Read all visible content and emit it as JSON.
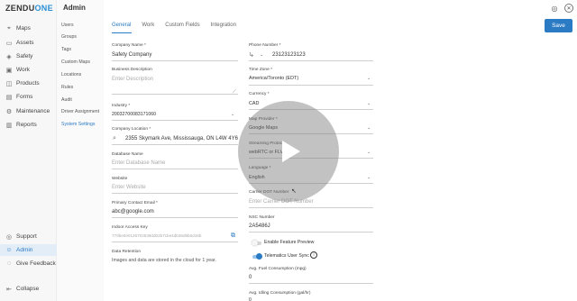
{
  "app": {
    "logo_main": "ZENDU",
    "logo_accent": "ONE",
    "page_title": "Admin"
  },
  "sidebar": {
    "items": [
      {
        "label": "Maps",
        "icon": "map-pin-icon"
      },
      {
        "label": "Assets",
        "icon": "car-icon"
      },
      {
        "label": "Safety",
        "icon": "shield-icon"
      },
      {
        "label": "Work",
        "icon": "briefcase-icon"
      },
      {
        "label": "Products",
        "icon": "box-icon"
      },
      {
        "label": "Forms",
        "icon": "document-icon"
      },
      {
        "label": "Maintenance",
        "icon": "wrench-icon"
      },
      {
        "label": "Reports",
        "icon": "chart-icon"
      }
    ],
    "bottom_items": [
      {
        "label": "Support",
        "icon": "headset-icon"
      },
      {
        "label": "Admin",
        "icon": "person-icon"
      },
      {
        "label": "Give Feedback",
        "icon": "chat-icon"
      },
      {
        "label": "Collapse",
        "icon": "collapse-icon"
      }
    ]
  },
  "subnav": {
    "items": [
      "Users",
      "Groups",
      "Tags",
      "Custom Maps",
      "Locations",
      "Rules",
      "Audit",
      "Driver Assignment",
      "System Settings"
    ]
  },
  "tabs": [
    "General",
    "Work",
    "Custom Fields",
    "Integration"
  ],
  "toolbar": {
    "save_label": "Save"
  },
  "left_form": {
    "company_name_label": "Company Name *",
    "company_name_value": "Safety Company",
    "business_desc_label": "Business Description",
    "business_desc_placeholder": "Enter Description",
    "industry_label": "Industry *",
    "industry_value": "20032700083171060",
    "company_location_label": "Company Location *",
    "company_location_value": "2355 Skymark Ave, Mississauga, ON L4W 4Y6",
    "database_name_label": "Database Name",
    "database_name_placeholder": "Enter Database Name",
    "website_label": "Website",
    "website_placeholder": "Enter Website",
    "primary_email_label": "Primary Contact Email *",
    "primary_email_value": "abc@google.com",
    "indoor_key_label": "Indoor Access Key",
    "indoor_key_value": "770be0e0126702839dd02b7cbe4db36d5b0d18b",
    "data_retention_label": "Data Retention",
    "data_retention_text": "Images and data are stored in the cloud for 1 year."
  },
  "right_form": {
    "phone_label": "Phone Number *",
    "phone_value": "23123123123",
    "timezone_label": "Time Zone *",
    "timezone_value": "America/Toronto (EDT)",
    "currency_label": "Currency *",
    "currency_value": "CAD",
    "map_provider_label": "Map Provider *",
    "map_provider_value": "Google Maps",
    "streaming_label": "Streaming Protoc",
    "streaming_value": "webRTC or FLV",
    "language_label": "Language *",
    "language_value": "English",
    "carrier_label": "Carrier DOT Number",
    "carrier_placeholder": "Enter Carrier DOT Number",
    "nsc_label": "NSC Number",
    "nsc_value": "2A5486J",
    "feature_preview_label": "Enable Feature Preview",
    "telematics_label": "Telematics User Sync",
    "fuel_label": "Avg. Fuel Consumption (mpg)",
    "fuel_value": "0",
    "idling_label": "Avg. Idling Consumption (gal/hr)",
    "idling_value": "0"
  },
  "colors": {
    "accent": "#2b7bc4",
    "sidebar_bg": "#f7f7f8",
    "active_bg": "#e3edf7"
  }
}
